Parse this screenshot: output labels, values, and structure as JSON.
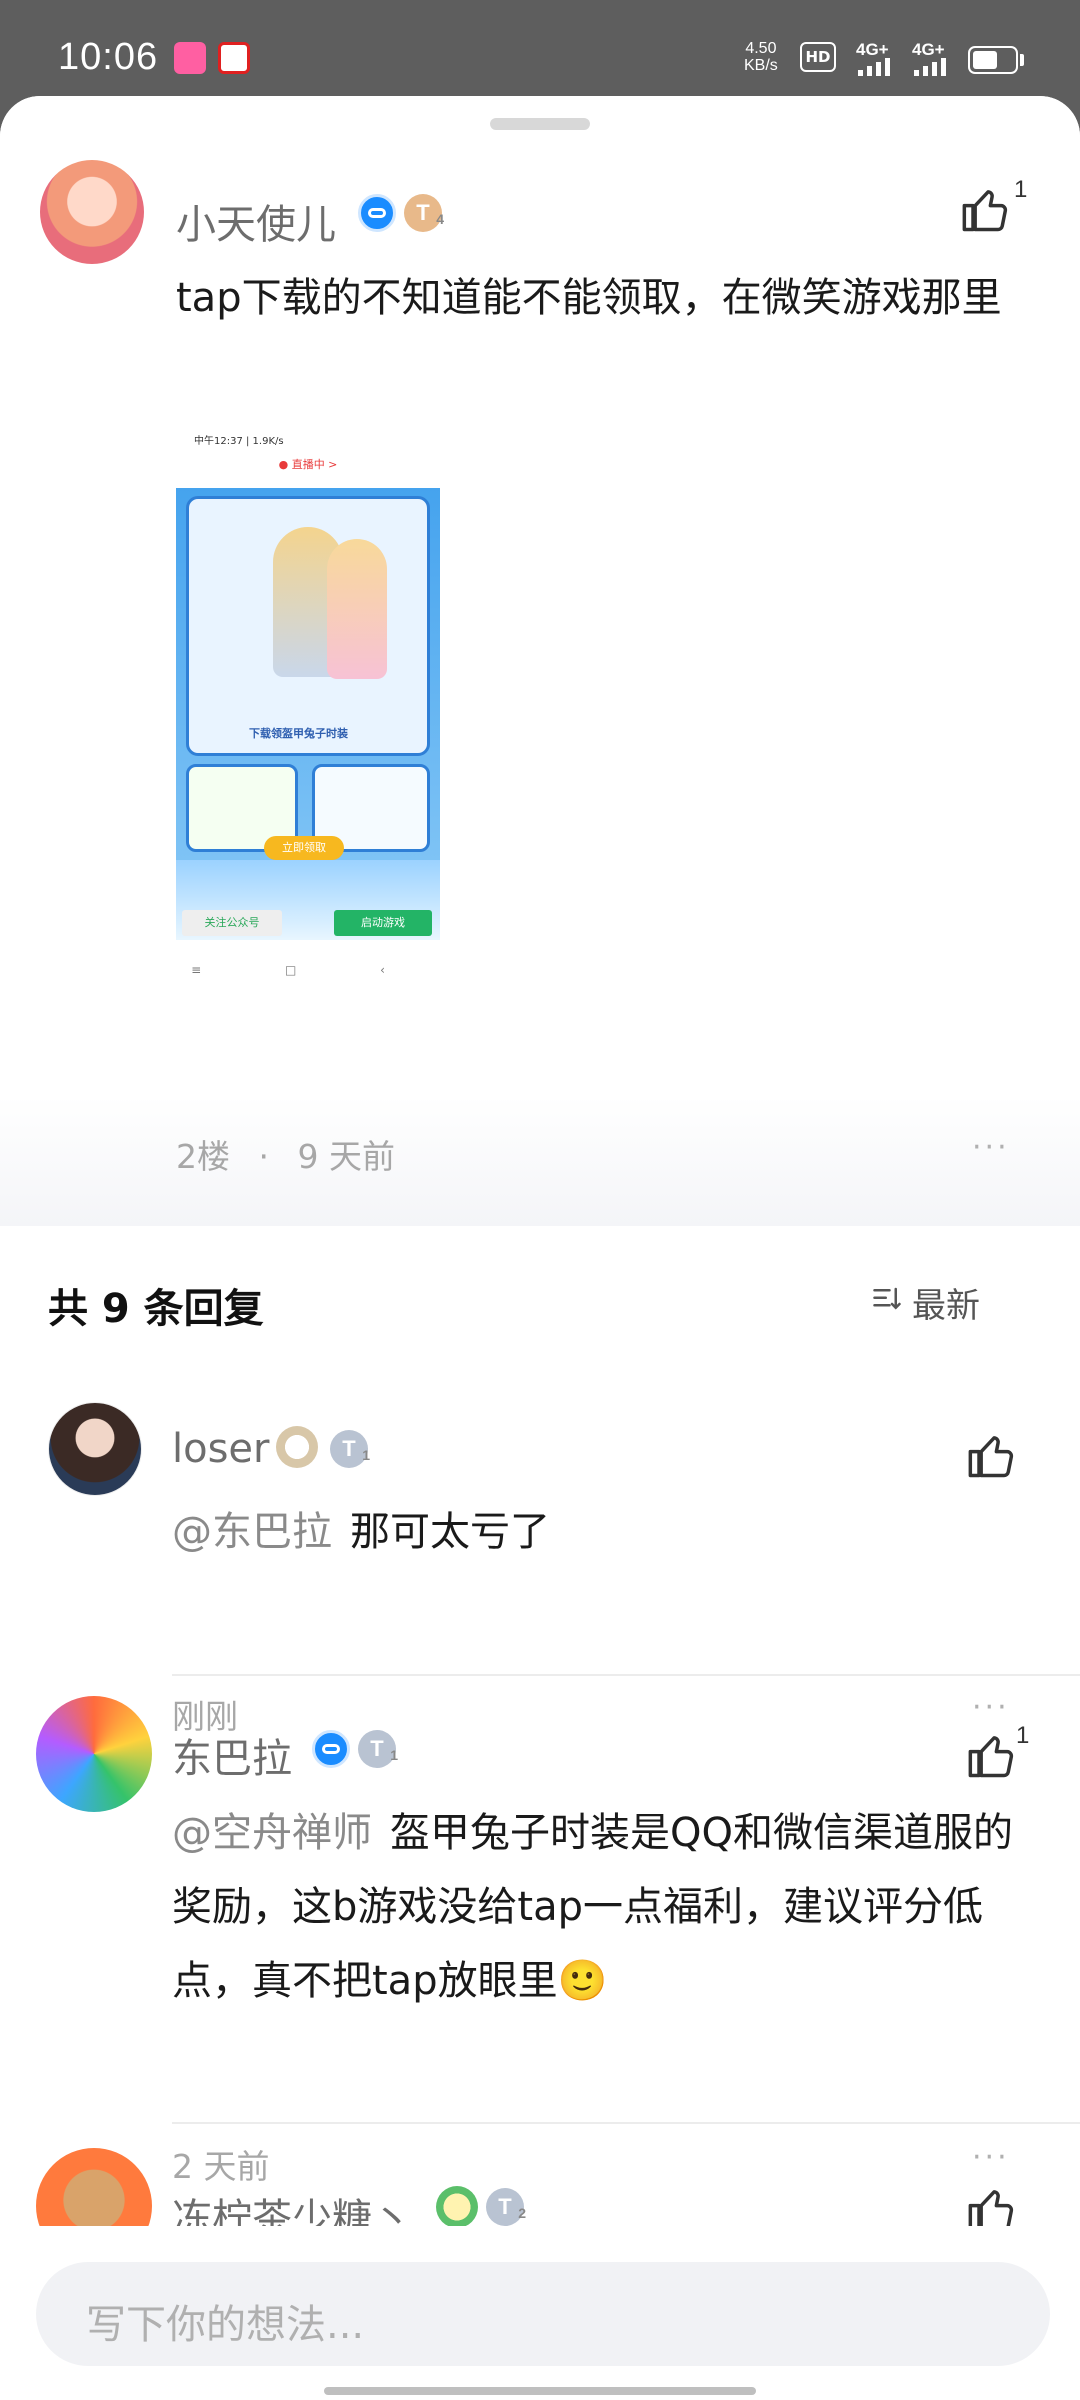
{
  "status_bar": {
    "time": "10:06",
    "speed_value": "4.50",
    "speed_unit": "KB/s",
    "hd": "HD",
    "sim1": "4G+",
    "sim2": "4G+"
  },
  "post": {
    "author": "小天使儿",
    "level_badge": "T",
    "level_num": "4",
    "like_count": "1",
    "text": "tap下载的不知道能不能领取，在微笑游戏那里",
    "floor": "2楼",
    "dot": "·",
    "time": "9 天前",
    "more": "···",
    "image": {
      "status": "中午12:37 | 1.9K/s",
      "nav_title": "● 直播中 >",
      "claim_button": "立即领取",
      "caption": "下载领盔甲兔子时装",
      "left_button": "关注公众号",
      "right_button": "启动游戏",
      "sys_nav": "≡ □ ‹"
    }
  },
  "replies_header": {
    "count_label": "共 9 条回复",
    "sort_label": "最新"
  },
  "replies": [
    {
      "author": "loser",
      "level_badge": "T",
      "level_num": "1",
      "mention": "@东巴拉",
      "text": "那可太亏了",
      "time": "刚刚",
      "like_count": "",
      "more": "···"
    },
    {
      "author": "东巴拉",
      "level_badge": "T",
      "level_num": "1",
      "mention": "@空舟禅师",
      "text": "盔甲兔子时装是QQ和微信渠道服的奖励，这b游戏没给tap一点福利，建议评分低点，真不把tap放眼里",
      "emoji": "🙂",
      "time": "2 天前",
      "like_count": "1",
      "more": "···"
    },
    {
      "author": "冻柠茶少糖丶",
      "level_badge": "T",
      "level_num": "2"
    }
  ],
  "composer": {
    "placeholder": "写下你的想法..."
  },
  "colors": {
    "accent_blue": "#1a8cff",
    "text_gray": "#6d6d6d",
    "meta_gray": "#a7a7a7"
  }
}
